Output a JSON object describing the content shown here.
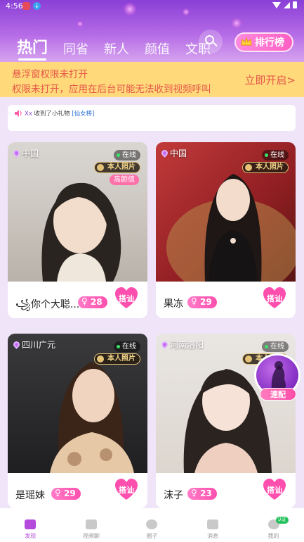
{
  "status_bar": {
    "time": "4:56"
  },
  "header": {
    "tabs": [
      {
        "label": "热门",
        "active": true
      },
      {
        "label": "同省",
        "active": false
      },
      {
        "label": "新人",
        "active": false
      },
      {
        "label": "颜值",
        "active": false
      },
      {
        "label": "文职",
        "active": false
      }
    ],
    "rank_label": "排行榜"
  },
  "notice": {
    "line1": "悬浮窗权限未打开",
    "line2": "权限未打开，应用在后台可能无法收到视频呼叫",
    "action": "立即开启>"
  },
  "ticker": {
    "user": "Xx",
    "text": " 收到了小礼物 ",
    "gift": "[仙女棒]"
  },
  "cards": [
    {
      "location": "中国",
      "status": "在线",
      "badge": "本人照片",
      "tag": "高颜值",
      "name": "꧁你个大聪...",
      "age": "28",
      "action": "搭讪"
    },
    {
      "location": "中国",
      "status": "在线",
      "badge": "本人照片",
      "tag": "",
      "name": "果冻",
      "age": "29",
      "action": "搭讪"
    },
    {
      "location": "四川广元",
      "status": "在线",
      "badge": "本人照片",
      "tag": "",
      "name": "是瑶妹",
      "age": "29",
      "action": "搭讪"
    },
    {
      "location": "河南洛阳",
      "status": "在线",
      "badge": "本人照片",
      "tag": "",
      "name": "沫子",
      "age": "23",
      "action": "搭讪"
    }
  ],
  "speed_match": {
    "label": "速配"
  },
  "bottom_nav": [
    {
      "label": "发现",
      "active": true
    },
    {
      "label": "视频聊",
      "active": false
    },
    {
      "label": "圈子",
      "active": false
    },
    {
      "label": "消息",
      "active": false
    },
    {
      "label": "我的",
      "active": false,
      "badge": "认证"
    }
  ],
  "colors": {
    "accent": "#b54bdc",
    "notice_bg": "#ffd97a",
    "notice_text": "#e6574a",
    "age_pill": "#ff4fae"
  }
}
